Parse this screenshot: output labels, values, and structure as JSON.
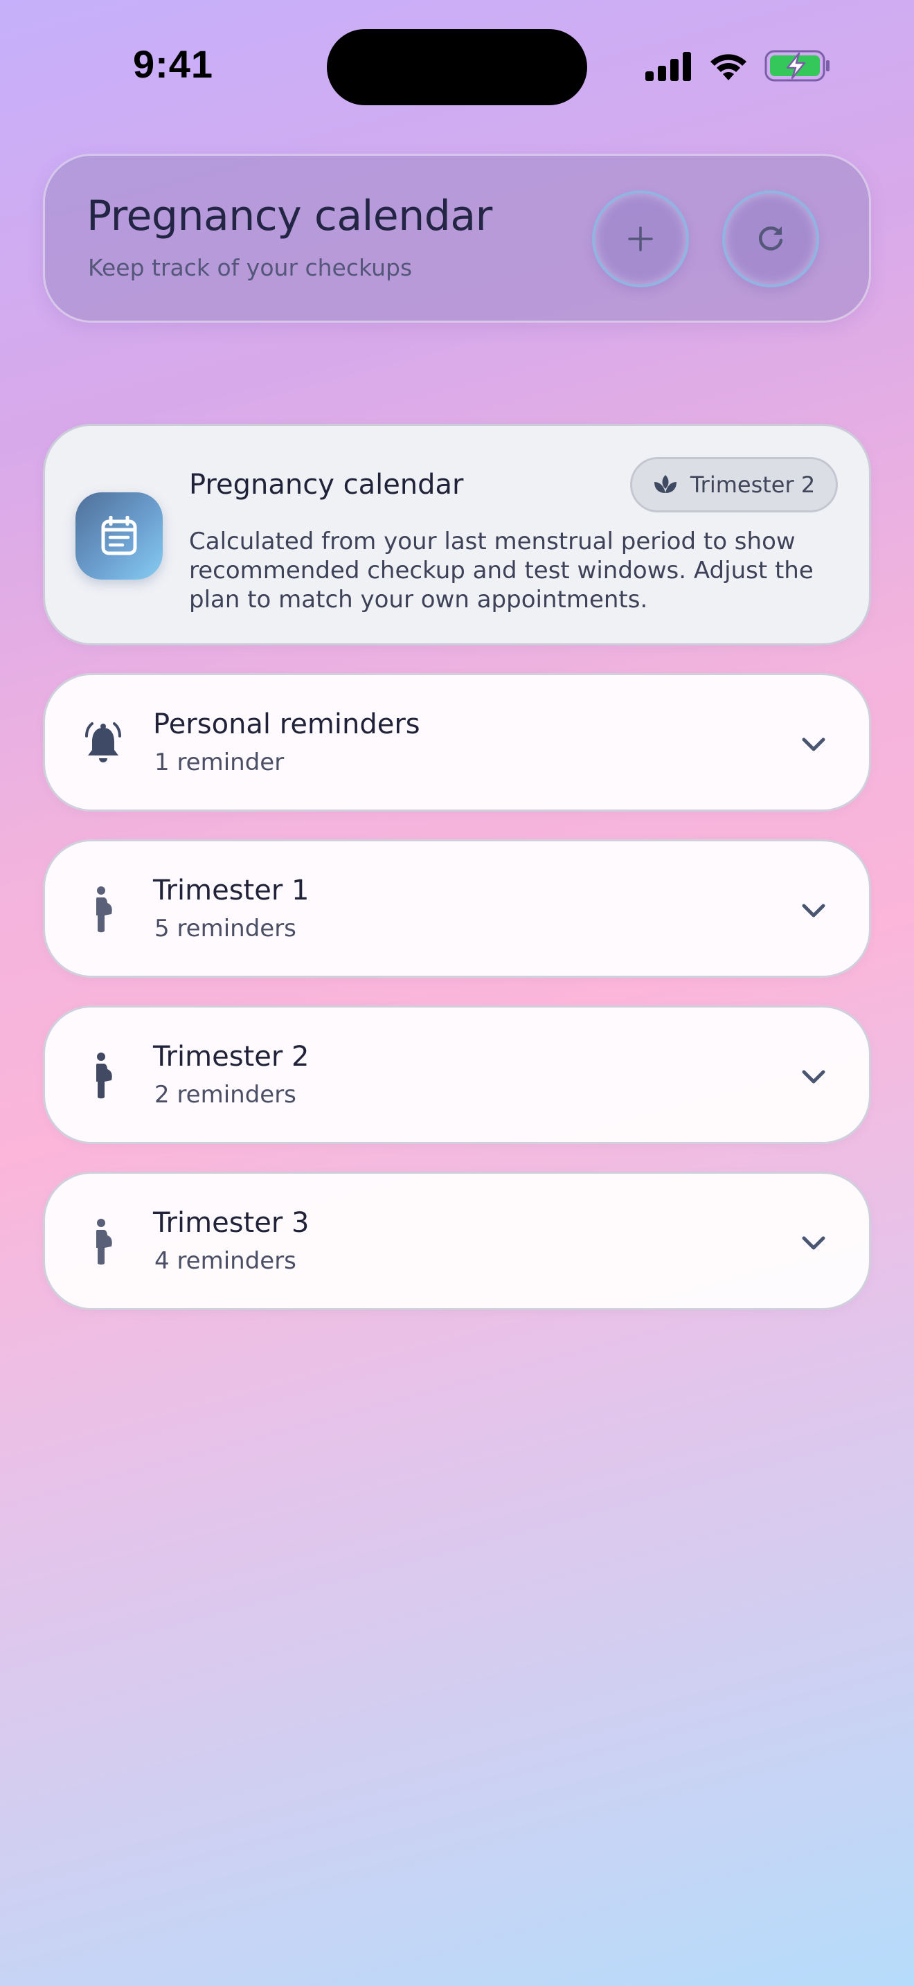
{
  "status_bar": {
    "time": "9:41",
    "icons": [
      "cellular-signal-icon",
      "wifi-icon",
      "battery-charging-icon"
    ],
    "battery_color": "#34c759"
  },
  "header": {
    "title": "Pregnancy calendar",
    "subtitle": "Keep track of your checkups",
    "add_icon": "plus-icon",
    "refresh_icon": "refresh-icon"
  },
  "info_card": {
    "icon": "calendar-note-icon",
    "title": "Pregnancy calendar",
    "badge": {
      "icon": "lotus-icon",
      "label": "Trimester 2"
    },
    "description": "Calculated from your last menstrual period to show recommended checkup and test windows. Adjust the plan to match your own appointments."
  },
  "sections": [
    {
      "icon": "bell-icon",
      "title": "Personal reminders",
      "subtitle": "1 reminder"
    },
    {
      "icon": "pregnant-person-icon",
      "title": "Trimester 1",
      "subtitle": "5 reminders"
    },
    {
      "icon": "pregnant-person-icon",
      "title": "Trimester 2",
      "subtitle": "2 reminders"
    },
    {
      "icon": "pregnant-person-icon",
      "title": "Trimester 3",
      "subtitle": "4 reminders"
    }
  ],
  "colors": {
    "accent_icon": "#4a5670",
    "text_primary": "#1f2238",
    "text_secondary": "#4b4f66"
  }
}
